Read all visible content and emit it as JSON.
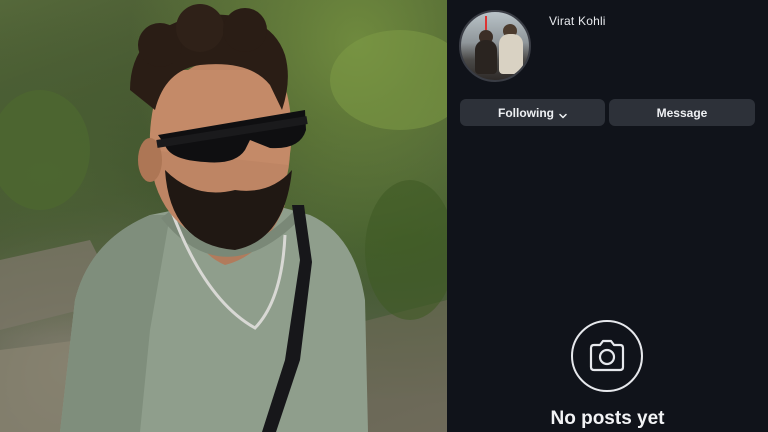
{
  "profile": {
    "username": "Virat Kohli",
    "following_label": "Following",
    "message_label": "Message",
    "empty_state": "No posts yet"
  },
  "icons": {
    "following_dropdown": "chevron-down-icon",
    "camera": "camera-icon"
  },
  "colors": {
    "background": "#10131a",
    "button": "#2d3139",
    "text": "#eef0f3"
  }
}
